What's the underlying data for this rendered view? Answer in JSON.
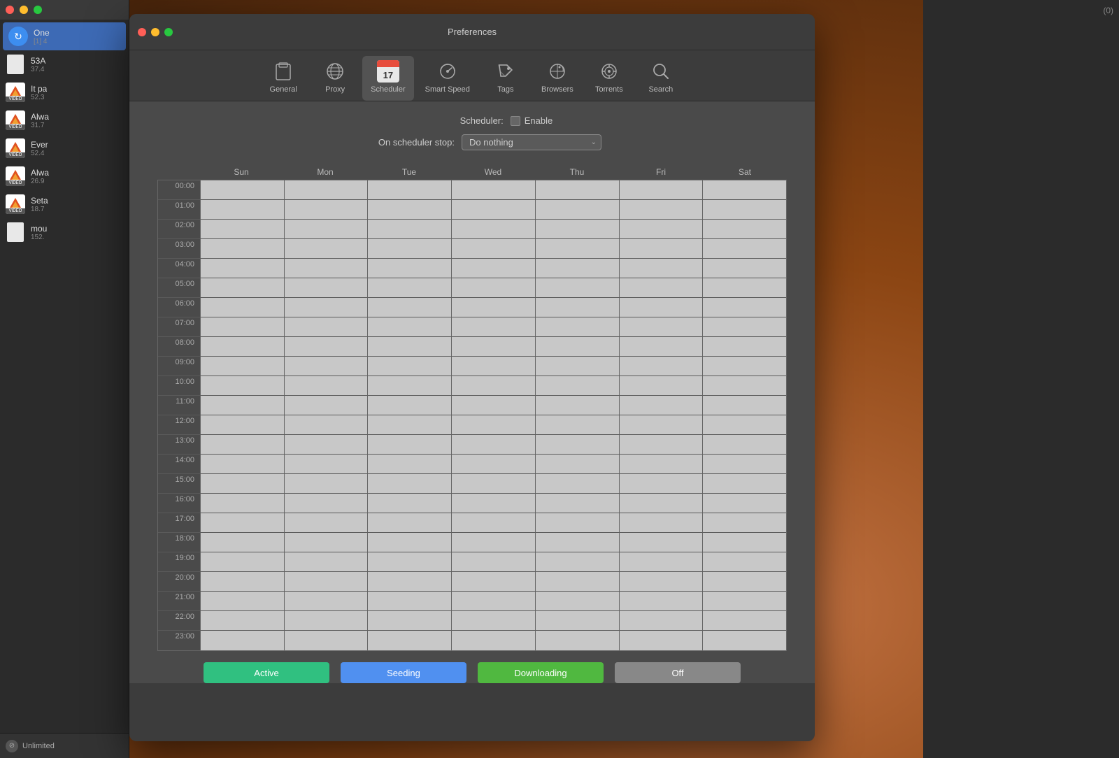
{
  "desktop": {
    "right_panel": {
      "counter": "(0)"
    }
  },
  "sidebar": {
    "items": [
      {
        "id": "item-1",
        "name": "One",
        "size": "[1] 4",
        "type": "circle",
        "active": true
      },
      {
        "id": "item-2",
        "name": "53A",
        "size": "37.4",
        "type": "doc"
      },
      {
        "id": "item-3",
        "name": "It pa",
        "size": "52.3",
        "type": "video"
      },
      {
        "id": "item-4",
        "name": "Alwa",
        "size": "31.7",
        "type": "video"
      },
      {
        "id": "item-5",
        "name": "Ever",
        "size": "52.4",
        "type": "video"
      },
      {
        "id": "item-6",
        "name": "Alwa",
        "size": "26.9",
        "type": "video"
      },
      {
        "id": "item-7",
        "name": "Seta",
        "size": "18.7",
        "type": "video"
      },
      {
        "id": "item-8",
        "name": "mou",
        "size": "152.",
        "type": "doc"
      }
    ],
    "footer": {
      "label": "Unlimited"
    }
  },
  "window": {
    "title": "Preferences",
    "toolbar": {
      "items": [
        {
          "id": "general",
          "label": "General",
          "icon": "phone"
        },
        {
          "id": "proxy",
          "label": "Proxy",
          "icon": "globe"
        },
        {
          "id": "scheduler",
          "label": "Scheduler",
          "icon": "calendar",
          "active": true
        },
        {
          "id": "smart-speed",
          "label": "Smart Speed",
          "icon": "speed"
        },
        {
          "id": "tags",
          "label": "Tags",
          "icon": "tag"
        },
        {
          "id": "browsers",
          "label": "Browsers",
          "icon": "compass"
        },
        {
          "id": "torrents",
          "label": "Torrents",
          "icon": "gear"
        },
        {
          "id": "search",
          "label": "Search",
          "icon": "search"
        }
      ]
    }
  },
  "scheduler": {
    "title_label": "Scheduler:",
    "enable_label": "Enable",
    "stop_label": "On scheduler stop:",
    "stop_value": "Do nothing",
    "days": [
      "Sun",
      "Mon",
      "Tue",
      "Wed",
      "Thu",
      "Fri",
      "Sat"
    ],
    "hours": [
      "00:00",
      "01:00",
      "02:00",
      "03:00",
      "04:00",
      "05:00",
      "06:00",
      "07:00",
      "08:00",
      "09:00",
      "10:00",
      "11:00",
      "12:00",
      "13:00",
      "14:00",
      "15:00",
      "16:00",
      "17:00",
      "18:00",
      "19:00",
      "20:00",
      "21:00",
      "22:00",
      "23:00"
    ]
  },
  "legend": {
    "active": "Active",
    "seeding": "Seeding",
    "downloading": "Downloading",
    "off": "Off"
  },
  "colors": {
    "active": "#30c080",
    "seeding": "#5090f0",
    "downloading": "#50b840",
    "off": "#888888"
  }
}
